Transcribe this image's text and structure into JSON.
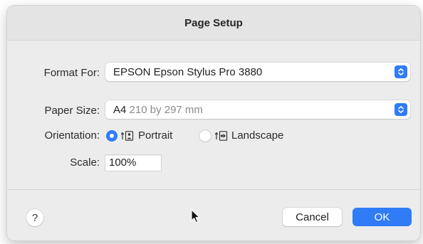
{
  "dialog": {
    "title": "Page Setup"
  },
  "format_for": {
    "label": "Format For:",
    "value": "EPSON Epson Stylus Pro 3880",
    "icon": "popup-chevrons-icon"
  },
  "paper_size": {
    "label": "Paper Size:",
    "name": "A4",
    "dimensions": "210 by 297 mm",
    "icon": "popup-chevrons-icon"
  },
  "orientation": {
    "label": "Orientation:",
    "options": [
      {
        "label": "Portrait",
        "selected": true,
        "icon": "portrait-orientation-icon"
      },
      {
        "label": "Landscape",
        "selected": false,
        "icon": "landscape-orientation-icon"
      }
    ]
  },
  "scale": {
    "label": "Scale:",
    "value": "100%"
  },
  "footer": {
    "help_label": "?",
    "cancel_label": "Cancel",
    "ok_label": "OK"
  },
  "colors": {
    "accent": "#2f7cf6",
    "dialog_bg": "#ececec"
  }
}
